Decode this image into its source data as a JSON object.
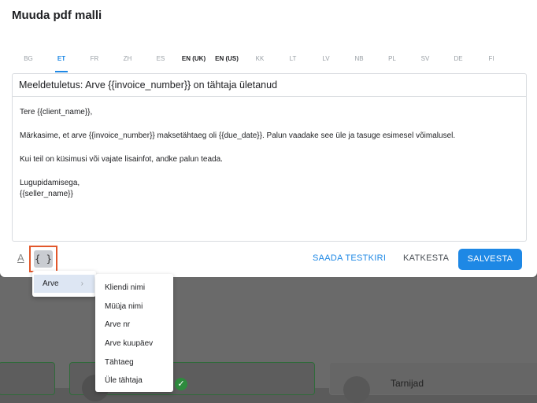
{
  "modal": {
    "title": "Muuda pdf malli"
  },
  "language_tabs": [
    {
      "label": "BG",
      "state": "inactive"
    },
    {
      "label": "ET",
      "state": "active"
    },
    {
      "label": "FR",
      "state": "inactive"
    },
    {
      "label": "ZH",
      "state": "inactive"
    },
    {
      "label": "ES",
      "state": "inactive"
    },
    {
      "label": "EN (UK)",
      "state": "bold"
    },
    {
      "label": "EN (US)",
      "state": "bold"
    },
    {
      "label": "KK",
      "state": "inactive"
    },
    {
      "label": "LT",
      "state": "inactive"
    },
    {
      "label": "LV",
      "state": "inactive"
    },
    {
      "label": "NB",
      "state": "inactive"
    },
    {
      "label": "PL",
      "state": "inactive"
    },
    {
      "label": "SV",
      "state": "inactive"
    },
    {
      "label": "DE",
      "state": "inactive"
    },
    {
      "label": "FI",
      "state": "inactive"
    }
  ],
  "editor": {
    "subject": "Meeldetuletus: Arve {{invoice_number}} on tähtaja ületanud",
    "body": {
      "greeting": "Tere {{client_name}},",
      "paragraph1": "Märkasime, et arve {{invoice_number}} maksetähtaeg oli {{due_date}}. Palun vaadake see üle ja tasuge esimesel võimalusel.",
      "paragraph2": "Kui teil on küsimusi või vajate lisainfot, andke palun teada.",
      "closing": "Lugupidamisega,",
      "signature": "{{seller_name}}"
    }
  },
  "toolbar": {
    "text_format_icon": "A",
    "variables_icon": "{ }",
    "send_test_label": "SAADA TESTKIRI",
    "cancel_label": "KATKESTA",
    "save_label": "SALVESTA"
  },
  "variable_menu": {
    "group_label": "Arve",
    "items": [
      "Kliendi nimi",
      "Müüja nimi",
      "Arve nr",
      "Arve kuupäev",
      "Tähtaeg",
      "Üle tähtaja"
    ]
  },
  "background": {
    "card_text": "Tarnijad",
    "check_icon": "✓"
  },
  "colors": {
    "accent": "#1e88e5",
    "highlight_border": "#e2572b",
    "menu_selected": "#dde6f3"
  }
}
